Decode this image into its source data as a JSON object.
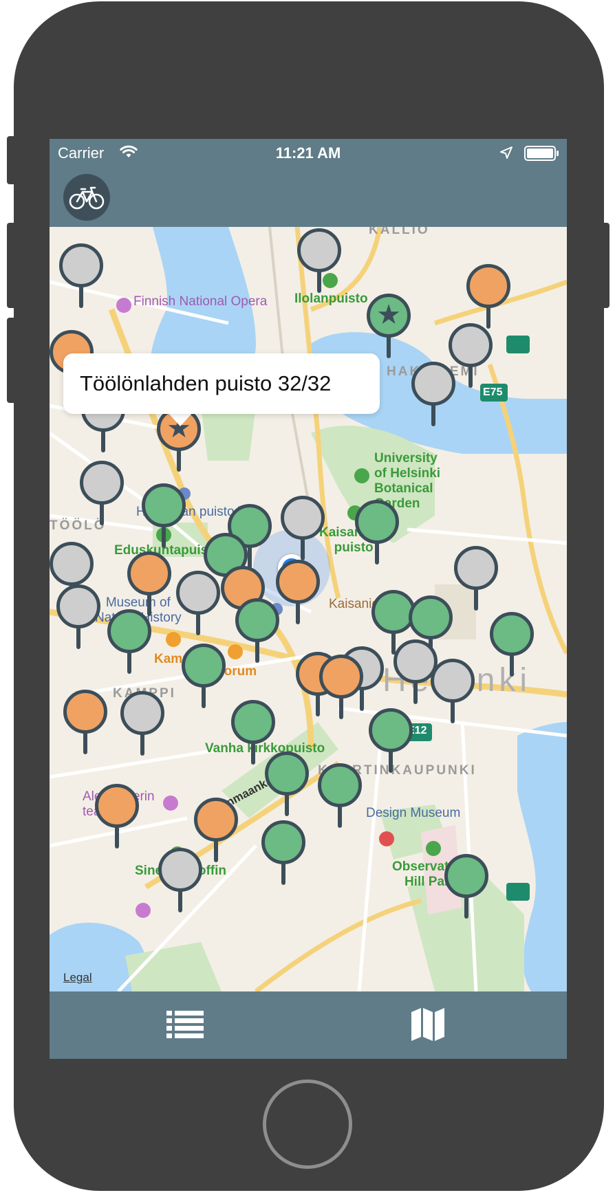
{
  "status_bar": {
    "carrier": "Carrier",
    "time": "11:21 AM",
    "icons": [
      "wifi-icon",
      "location-arrow-icon",
      "battery-icon"
    ]
  },
  "nav_bar": {
    "icon": "bicycle-icon"
  },
  "callout": {
    "text": "Töölönlahden puisto 32/32"
  },
  "map": {
    "legal_label": "Legal",
    "labels": [
      {
        "text": "Finnish\nNational Opera",
        "style": "purple"
      },
      {
        "text": "Ilolanpuisto",
        "style": "green"
      },
      {
        "text": "KALLIO",
        "style": "gray"
      },
      {
        "text": "HAKANIEMI",
        "style": "gray"
      },
      {
        "text": "E75",
        "style": "road"
      },
      {
        "text": "University\nof Helsinki\nBotanical\nGarden",
        "style": "green"
      },
      {
        "text": "Hesperian puisto Villa",
        "style": "blue"
      },
      {
        "text": "Eduskuntapuisto",
        "style": "green"
      },
      {
        "text": "Kaisaniemi\npuisto",
        "style": "green"
      },
      {
        "text": "TÖÖLÖ",
        "style": "gray"
      },
      {
        "text": "Museum of\nNatural History",
        "style": "blue"
      },
      {
        "text": "Kamppi",
        "style": "orange"
      },
      {
        "text": "Forum",
        "style": "orange"
      },
      {
        "text": "KAMPPI",
        "style": "gray"
      },
      {
        "text": "Helsinki",
        "style": "big"
      },
      {
        "text": "E12",
        "style": "road"
      },
      {
        "text": "Vanha kirkkopuisto",
        "style": "green"
      },
      {
        "text": "KAARTINKAUPUNKI",
        "style": "gray"
      },
      {
        "text": "Aleksanterin\nteatteri",
        "style": "purple"
      },
      {
        "text": "Uudenmaankatu",
        "style": "street"
      },
      {
        "text": "Design Museum",
        "style": "blue"
      },
      {
        "text": "Sinebrychoffin",
        "style": "green"
      },
      {
        "text": "Observatory\nHill Park",
        "style": "green"
      },
      {
        "text": "Kaisaniemi",
        "style": "brown"
      }
    ],
    "pins": [
      {
        "status": "gray",
        "star": false
      },
      {
        "status": "gray",
        "star": false
      },
      {
        "status": "green",
        "star": true
      },
      {
        "status": "orange",
        "star": false
      },
      {
        "status": "gray",
        "star": false
      },
      {
        "status": "gray",
        "star": false
      },
      {
        "status": "orange",
        "star": false
      },
      {
        "status": "gray",
        "star": false
      },
      {
        "status": "orange",
        "star": true
      },
      {
        "status": "gray",
        "star": false
      },
      {
        "status": "green",
        "star": false
      },
      {
        "status": "green",
        "star": false
      },
      {
        "status": "gray",
        "star": false
      },
      {
        "status": "green",
        "star": false
      },
      {
        "status": "gray",
        "star": false
      },
      {
        "status": "orange",
        "star": false
      },
      {
        "status": "green",
        "star": false
      },
      {
        "status": "orange",
        "star": false
      },
      {
        "status": "orange",
        "star": false
      },
      {
        "status": "gray",
        "star": false
      },
      {
        "status": "gray",
        "star": false
      },
      {
        "status": "green",
        "star": false
      },
      {
        "status": "gray",
        "star": false
      },
      {
        "status": "green",
        "star": false
      },
      {
        "status": "green",
        "star": false
      },
      {
        "status": "green",
        "star": false
      },
      {
        "status": "green",
        "star": false
      },
      {
        "status": "orange",
        "star": false
      },
      {
        "status": "gray",
        "star": false
      },
      {
        "status": "gray",
        "star": false
      },
      {
        "status": "gray",
        "star": false
      },
      {
        "status": "orange",
        "star": false
      },
      {
        "status": "gray",
        "star": false
      },
      {
        "status": "green",
        "star": false
      },
      {
        "status": "green",
        "star": false
      },
      {
        "status": "green",
        "star": false
      },
      {
        "status": "green",
        "star": false
      },
      {
        "status": "orange",
        "star": false
      },
      {
        "status": "orange",
        "star": false
      },
      {
        "status": "green",
        "star": false
      },
      {
        "status": "gray",
        "star": false
      },
      {
        "status": "green",
        "star": false
      },
      {
        "status": "green",
        "star": false
      },
      {
        "status": "orange",
        "star": false
      }
    ]
  },
  "tab_bar": {
    "tabs": [
      {
        "icon": "list-icon"
      },
      {
        "icon": "map-icon"
      }
    ]
  },
  "colors": {
    "bar_background": "#607c88",
    "pin_green": "#6cba84",
    "pin_orange": "#f0a262",
    "pin_gray": "#cecece",
    "pin_outline": "#3c4e59",
    "user_location": "#1e7cf2"
  }
}
